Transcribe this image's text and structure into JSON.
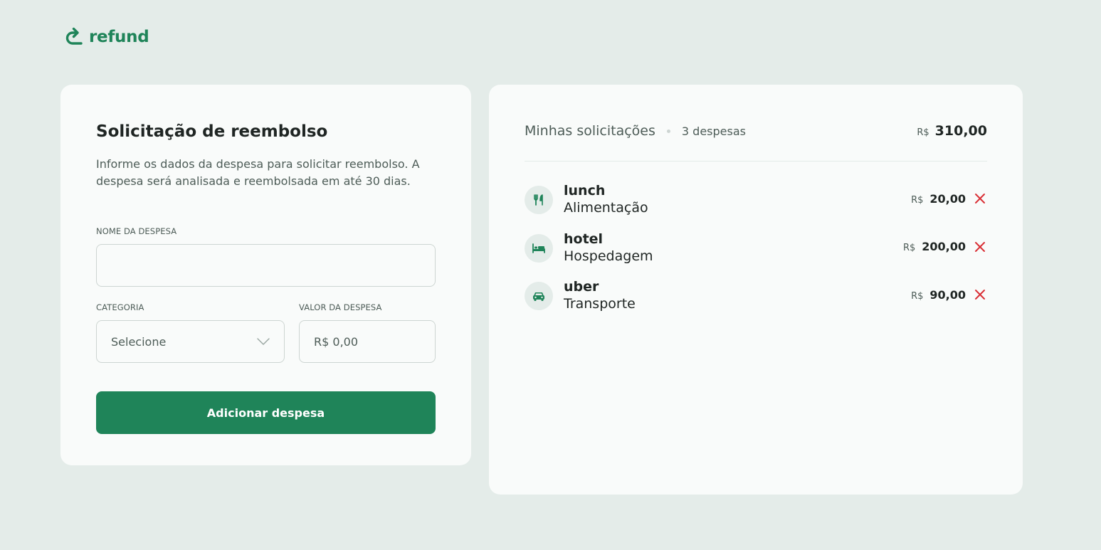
{
  "brand": {
    "name": "refund",
    "logo_icon": "redo-arrow-icon",
    "color": "#1F8459"
  },
  "form": {
    "title": "Solicitação de reembolso",
    "description": "Informe os dados da despesa para solicitar reembolso. A despesa será analisada e reembolsada em até 30 dias.",
    "name_label": "NOME DA DESPESA",
    "name_value": "",
    "category_label": "CATEGORIA",
    "category_selected": "Selecione",
    "amount_label": "VALOR DA DESPESA",
    "amount_placeholder": "R$ 0,00",
    "submit_label": "Adicionar despesa"
  },
  "summary": {
    "title": "Minhas solicitações",
    "count": "3 despesas",
    "currency": "R$",
    "total": "310,00"
  },
  "expenses": [
    {
      "name": "lunch",
      "category": "Alimentação",
      "currency": "R$",
      "amount": "20,00",
      "icon": "food-icon"
    },
    {
      "name": "hotel",
      "category": "Hospedagem",
      "currency": "R$",
      "amount": "200,00",
      "icon": "bed-icon"
    },
    {
      "name": "uber",
      "category": "Transporte",
      "currency": "R$",
      "amount": "90,00",
      "icon": "car-icon"
    }
  ],
  "colors": {
    "accent": "#1F8459",
    "danger": "#D93036",
    "background": "#E4ECE9",
    "card": "#F9FBFA"
  }
}
